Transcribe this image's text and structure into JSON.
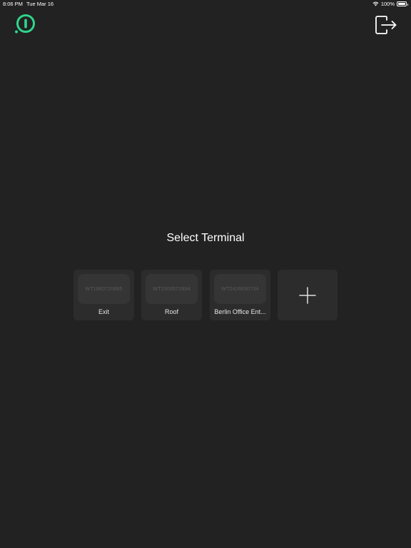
{
  "status_bar": {
    "time": "8:06 PM",
    "date": "Tue Mar 16",
    "battery": "100%"
  },
  "icons": {
    "logo": "power-logo-icon",
    "logout": "logout-icon",
    "add": "plus-icon",
    "wifi": "wifi-icon",
    "battery": "battery-icon"
  },
  "colors": {
    "background": "#222222",
    "card": "#2c2c2c",
    "thumb": "#353535",
    "accent": "#2fd58c"
  },
  "main": {
    "title": "Select Terminal",
    "terminals": [
      {
        "serial": "WT1860720865",
        "name": "Exit"
      },
      {
        "serial": "WT1506572894",
        "name": "Roof"
      },
      {
        "serial": "WT2426830734",
        "name": "Berlin Office Ent..."
      }
    ]
  }
}
